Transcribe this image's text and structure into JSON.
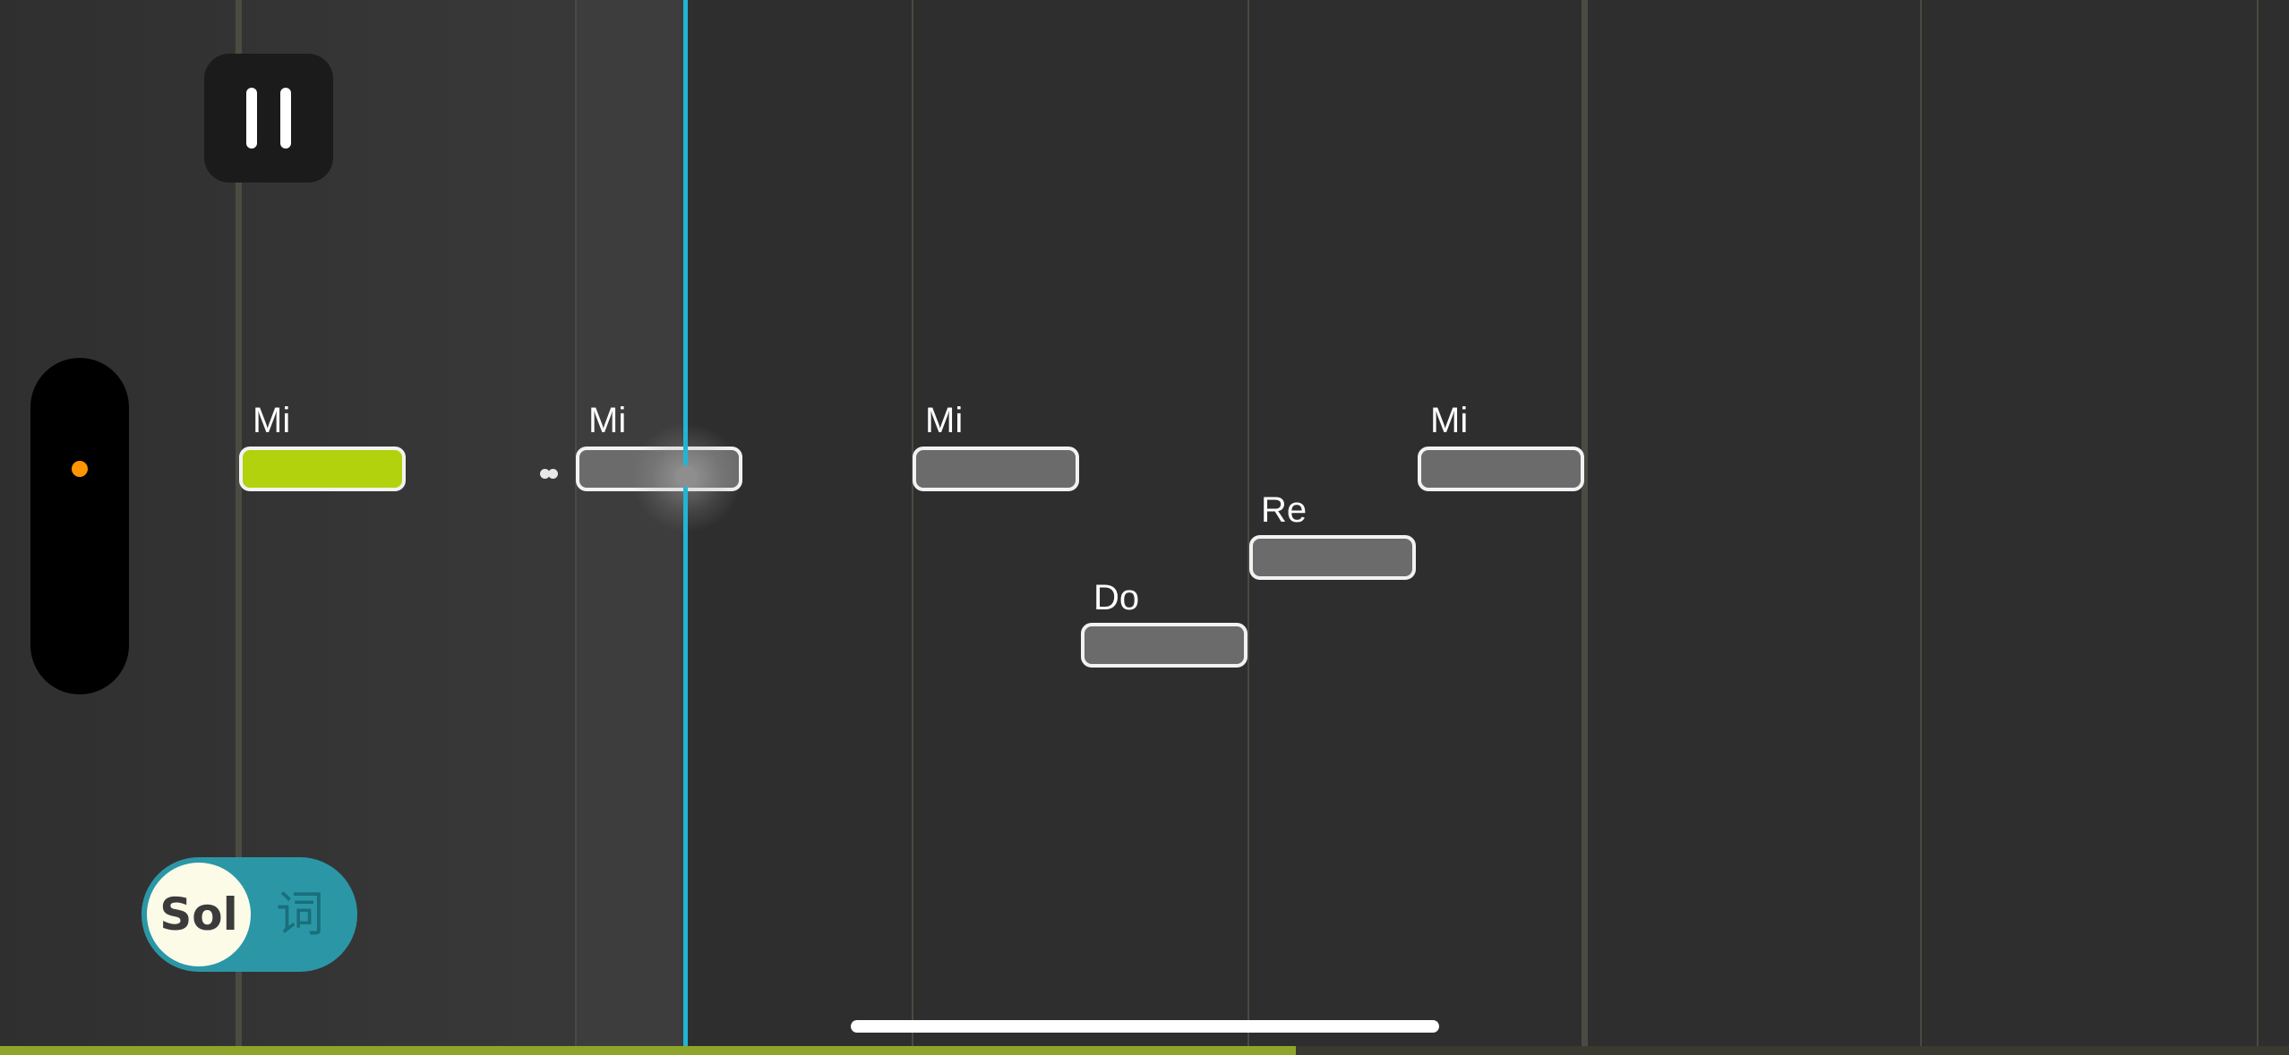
{
  "controls": {
    "pause_button": {
      "icon": "pause-icon"
    },
    "pitch_meter": {
      "indicator_color": "#ff9500"
    },
    "mode_toggle": {
      "active_label": "Sol",
      "inactive_label": "词"
    }
  },
  "notes": [
    {
      "label": "Mi",
      "state": "sung"
    },
    {
      "label": "Mi",
      "state": "current"
    },
    {
      "label": "Mi",
      "state": "upcoming"
    },
    {
      "label": "Do",
      "state": "upcoming"
    },
    {
      "label": "Re",
      "state": "upcoming"
    },
    {
      "label": "Mi",
      "state": "upcoming"
    }
  ],
  "playback": {
    "progress_fraction": 0.566
  },
  "colors": {
    "background": "#2e2e2e",
    "sung_note": "#b2d20d",
    "upcoming_note": "#6b6b6b",
    "playhead": "#22b4d6",
    "toggle": "#2b97a6",
    "progress": "#8ea52a"
  }
}
